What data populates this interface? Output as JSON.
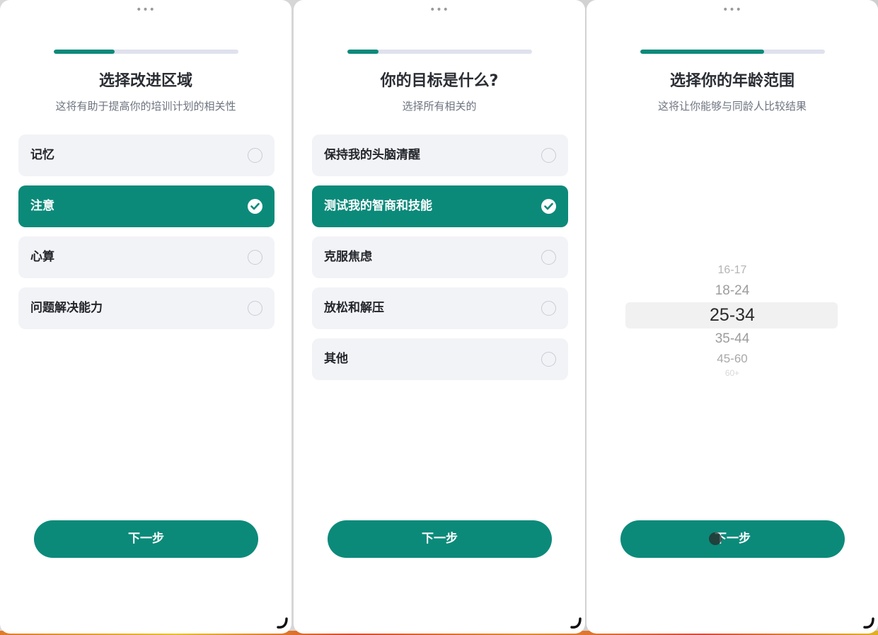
{
  "screens": [
    {
      "progress": 0.33,
      "title": "选择改进区域",
      "subtitle": "这将有助于提高你的培训计划的相关性",
      "options": [
        {
          "label": "记忆",
          "selected": false
        },
        {
          "label": "注意",
          "selected": true
        },
        {
          "label": "心算",
          "selected": false
        },
        {
          "label": "问题解决能力",
          "selected": false
        }
      ],
      "next_label": "下一步"
    },
    {
      "progress": 0.17,
      "title": "你的目标是什么?",
      "subtitle": "选择所有相关的",
      "options": [
        {
          "label": "保持我的头脑清醒",
          "selected": false
        },
        {
          "label": "测试我的智商和技能",
          "selected": true
        },
        {
          "label": "克服焦虑",
          "selected": false
        },
        {
          "label": "放松和解压",
          "selected": false
        },
        {
          "label": "其他",
          "selected": false
        }
      ],
      "next_label": "下一步"
    },
    {
      "progress": 0.67,
      "title": "选择你的年龄范围",
      "subtitle": "这将让你能够与同龄人比较结果",
      "age_options": [
        "16-17",
        "18-24",
        "25-34",
        "35-44",
        "45-60",
        "60+"
      ],
      "selected_age": "25-34",
      "next_label": "下一步"
    }
  ],
  "grabber_symbol": "•••",
  "colors": {
    "accent": "#0b8a7a",
    "option_bg": "#f2f3f7",
    "progress_track": "#dfe1ee"
  }
}
